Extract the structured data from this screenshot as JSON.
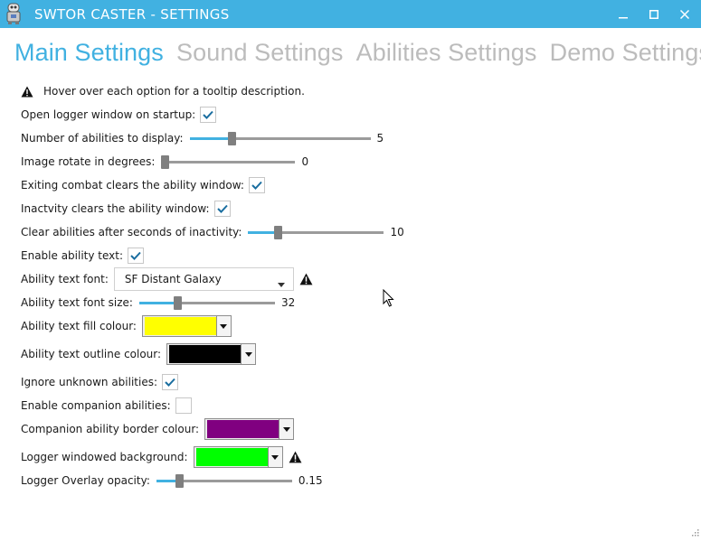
{
  "window": {
    "title": "SWTOR CASTER - SETTINGS",
    "app_icon": "robot-icon",
    "controls": [
      "minimize-icon",
      "maximize-icon",
      "close-icon"
    ],
    "accent_color": "#41b1e1"
  },
  "tabs": [
    {
      "label": "Main Settings",
      "active": true
    },
    {
      "label": "Sound Settings",
      "active": false
    },
    {
      "label": "Abilities Settings",
      "active": false
    },
    {
      "label": "Demo Settings",
      "active": false
    }
  ],
  "settings": {
    "hint": "Hover over each option for a tooltip description.",
    "open_logger": {
      "label": "Open logger window on startup:",
      "checked": true
    },
    "num_abilities": {
      "label": "Number of abilities to display:",
      "value": "5",
      "fraction": 0.22
    },
    "image_rotate": {
      "label": "Image rotate in degrees:",
      "value": "0",
      "fraction": 0.0
    },
    "exit_combat_clears": {
      "label": "Exiting combat clears the ability window:",
      "checked": true
    },
    "inactivity_clears": {
      "label": "Inactvity clears the ability window:",
      "checked": true
    },
    "clear_after_seconds": {
      "label": "Clear abilities after seconds of inactivity:",
      "value": "10",
      "fraction": 0.2
    },
    "enable_ability_text": {
      "label": "Enable ability text:",
      "checked": true
    },
    "ability_text_font": {
      "label": "Ability text font:",
      "value": "SF Distant Galaxy"
    },
    "ability_text_font_size": {
      "label": "Ability text font size:",
      "value": "32",
      "fraction": 0.27
    },
    "ability_text_fill": {
      "label": "Ability text fill colour:",
      "color": "#ffff00"
    },
    "ability_text_outline": {
      "label": "Ability text outline colour:",
      "color": "#000000"
    },
    "ignore_unknown": {
      "label": "Ignore unknown abilities:",
      "checked": true
    },
    "enable_companion": {
      "label": "Enable companion abilities:",
      "checked": false
    },
    "companion_border": {
      "label": "Companion ability border colour:",
      "color": "#800080"
    },
    "logger_background": {
      "label": "Logger windowed background:",
      "color": "#00ff00"
    },
    "overlay_opacity": {
      "label": "Logger Overlay opacity:",
      "value": "0.15",
      "fraction": 0.15
    }
  }
}
